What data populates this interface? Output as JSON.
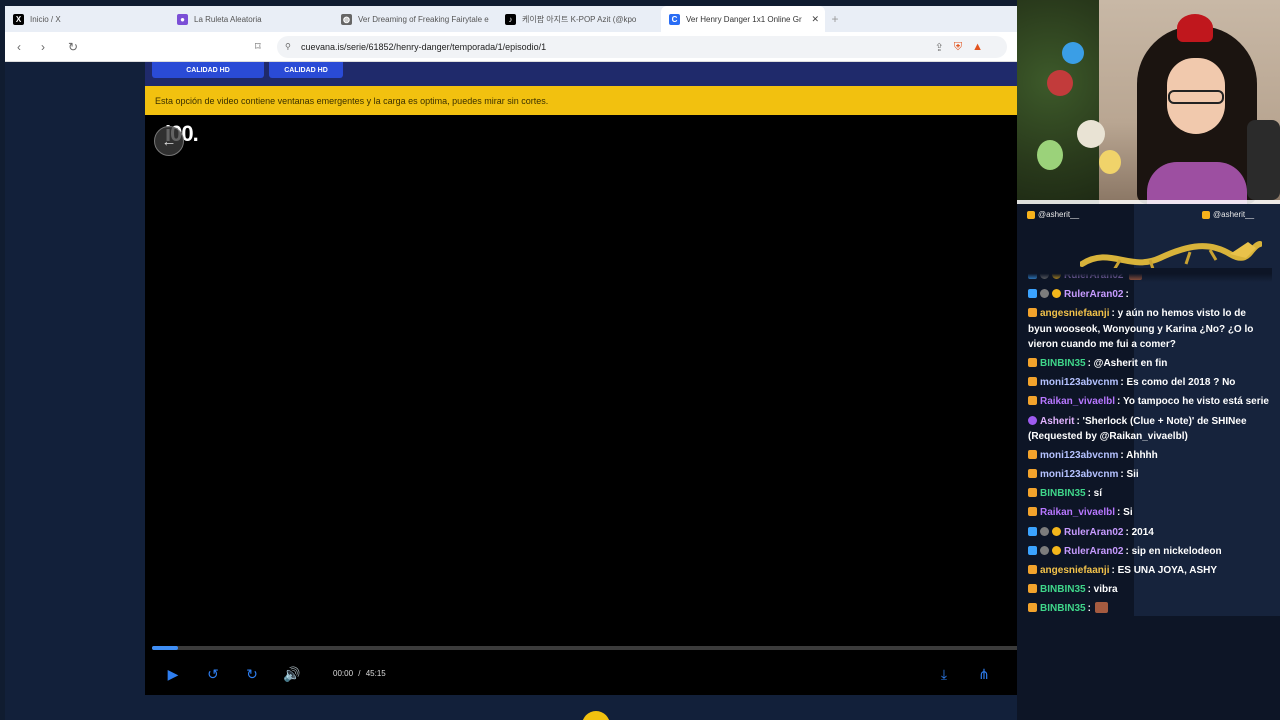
{
  "browser": {
    "tabs": [
      {
        "title": "Inicio / X",
        "icon": "x-logo-icon",
        "icon_glyph": "X",
        "icon_bg": "#000000",
        "active": false
      },
      {
        "title": "La Ruleta Aleatoria",
        "icon": "wheel-icon",
        "icon_glyph": "●",
        "icon_bg": "#7b4fd6",
        "active": false
      },
      {
        "title": "Ver Dreaming of Freaking Fairytale e",
        "icon": "globe-icon",
        "icon_glyph": "◍",
        "icon_bg": "#666666",
        "active": false
      },
      {
        "title": "케이팝 아지트 K-POP Azit (@kpo",
        "icon": "tiktok-icon",
        "icon_glyph": "♪",
        "icon_bg": "#000000",
        "active": false
      },
      {
        "title": "Ver Henry Danger 1x1 Online Gr",
        "icon": "cuevana-icon",
        "icon_glyph": "C",
        "icon_bg": "#2a6df4",
        "active": true
      }
    ],
    "close_glyph": "✕",
    "newtab_glyph": "+",
    "back_glyph": "‹",
    "forward_glyph": "›",
    "reload_glyph": "↻",
    "bookmark_glyph": "⌑",
    "lock_glyph": "⚲",
    "url": "cuevana.is/serie/61852/henry-danger/temporada/1/episodio/1",
    "url_icons": [
      "⇪",
      "⛨",
      "▲"
    ]
  },
  "page": {
    "quality_buttons": [
      "CALIDAD HD",
      "CALIDAD HD"
    ],
    "warning": "Esta opción de video contiene ventanas emergentes y la carga es optima, puedes mirar sin cortes.",
    "player_logo": "i00.",
    "back_glyph": "←",
    "progress_fraction": 0.027,
    "current_time": "00:00",
    "time_separator": "/",
    "duration": "45:15",
    "controls": {
      "play": "▶",
      "rewind": "↺",
      "forward": "↻",
      "volume": "🔊",
      "download": "⤓",
      "share": "⋔",
      "settings": "⚙",
      "pip": "⧉",
      "fullscreen": "⤢"
    },
    "accent_color": "#2e7ef0",
    "warning_color": "#f2c10f"
  },
  "chat": {
    "header_left": "@asherit__",
    "header_right": "@asherit__",
    "messages": [
      {
        "badges": [
          "blue",
          "gray",
          "gold"
        ],
        "user": "RulerAran02",
        "color": "#c79bff",
        "text": "",
        "emote": true
      },
      {
        "badges": [
          "blue",
          "gray",
          "gold"
        ],
        "user": "RulerAran02",
        "color": "#c79bff",
        "text": ":",
        "emote": false
      },
      {
        "badges": [
          "sub"
        ],
        "user": "angesniefaanji",
        "color": "#f2c24a",
        "text": ": y aún no hemos visto lo de byun wooseok, Wonyoung y Karina ¿No? ¿O lo vieron cuando me fui a comer?",
        "emote": false
      },
      {
        "badges": [
          "sub"
        ],
        "user": "BINBIN35",
        "color": "#3fd68a",
        "text": ": @Asherit en fin",
        "emote": false
      },
      {
        "badges": [
          "sub"
        ],
        "user": "moni123abvcnm",
        "color": "#b5c2ff",
        "text": ": Es como del 2018 ? No",
        "emote": false
      },
      {
        "badges": [
          "sub"
        ],
        "user": "Raikan_vivaelbl",
        "color": "#b777ff",
        "text": ": Yo tampoco he visto está serie",
        "emote": false
      },
      {
        "badges": [
          "mod"
        ],
        "user": "Asherit",
        "color": "#e2b4ff",
        "text": ": 'Sherlock (Clue + Note)' de SHINee (Requested by @Raikan_vivaelbl)",
        "emote": false
      },
      {
        "badges": [
          "sub"
        ],
        "user": "moni123abvcnm",
        "color": "#b5c2ff",
        "text": ": Ahhhh",
        "emote": false
      },
      {
        "badges": [
          "sub"
        ],
        "user": "moni123abvcnm",
        "color": "#b5c2ff",
        "text": ": Sii",
        "emote": false
      },
      {
        "badges": [
          "sub"
        ],
        "user": "BINBIN35",
        "color": "#3fd68a",
        "text": ": sí",
        "emote": false
      },
      {
        "badges": [
          "sub"
        ],
        "user": "Raikan_vivaelbl",
        "color": "#b777ff",
        "text": ": Si",
        "emote": false
      },
      {
        "badges": [
          "blue",
          "gray",
          "gold"
        ],
        "user": "RulerAran02",
        "color": "#c79bff",
        "text": ": 2014",
        "emote": false
      },
      {
        "badges": [
          "blue",
          "gray",
          "gold"
        ],
        "user": "RulerAran02",
        "color": "#c79bff",
        "text": ": sip en nickelodeon",
        "emote": false
      },
      {
        "badges": [
          "sub"
        ],
        "user": "angesniefaanji",
        "color": "#f2c24a",
        "text": ": ES UNA JOYA, ASHY",
        "emote": false
      },
      {
        "badges": [
          "sub"
        ],
        "user": "BINBIN35",
        "color": "#3fd68a",
        "text": ": vibra",
        "emote": false
      },
      {
        "badges": [
          "sub"
        ],
        "user": "BINBIN35",
        "color": "#3fd68a",
        "text": ":",
        "emote": true
      }
    ]
  }
}
